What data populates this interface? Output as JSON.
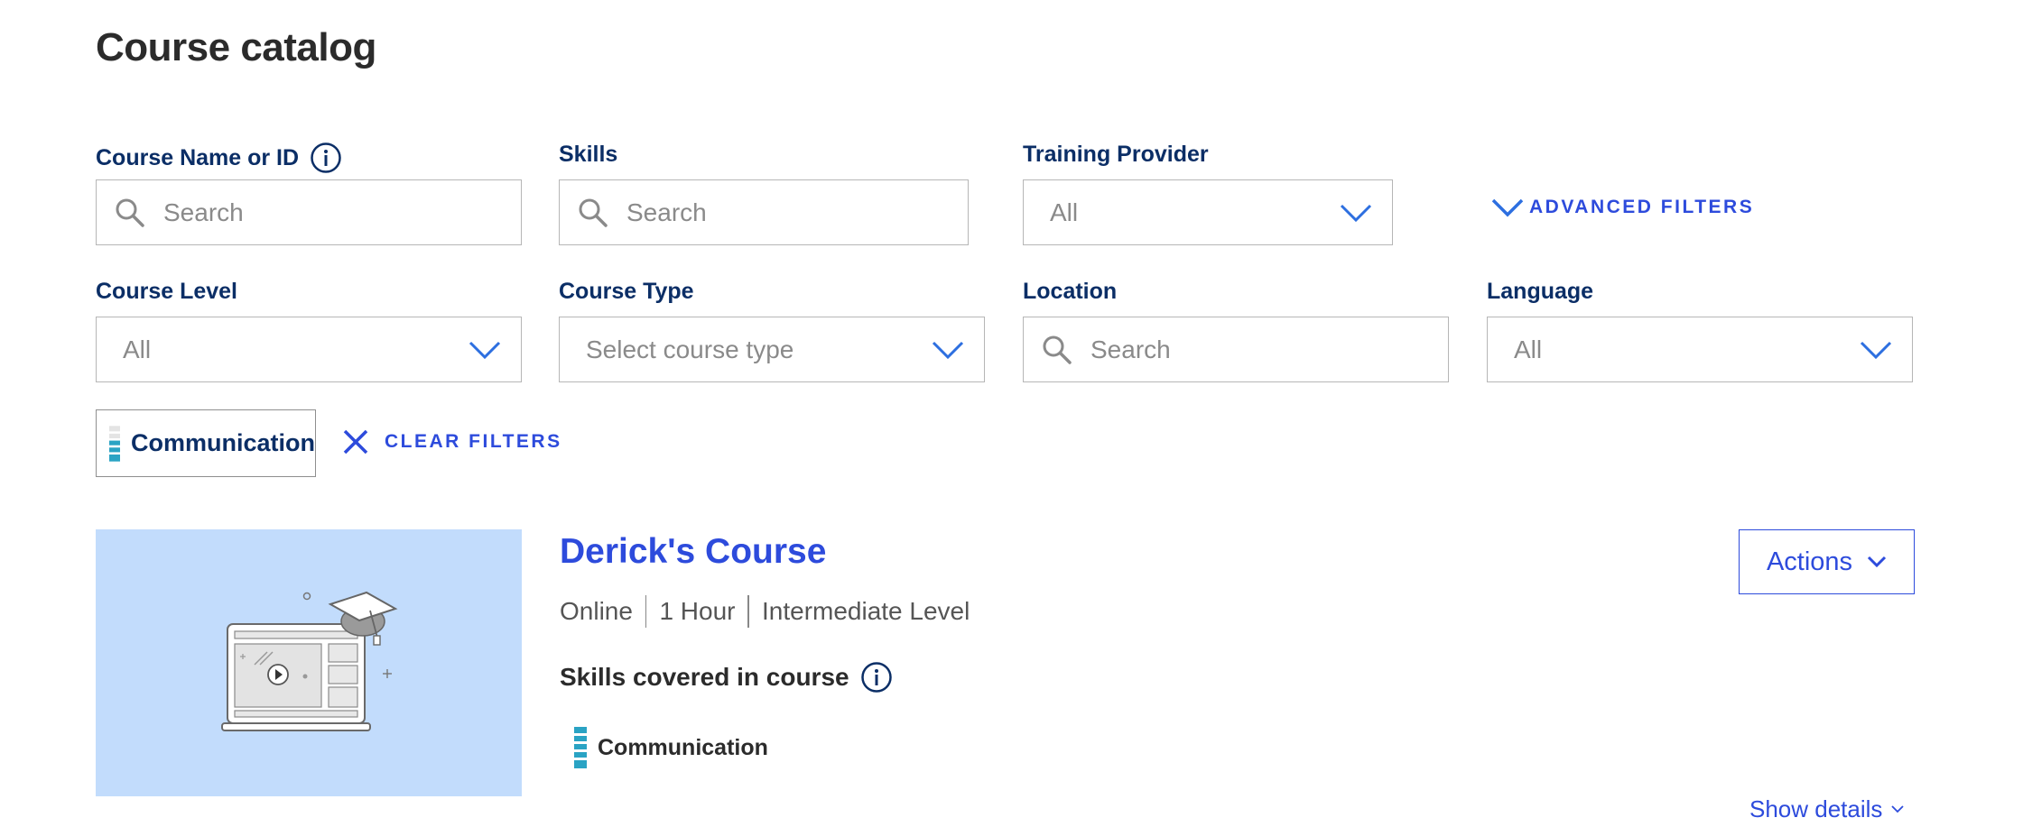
{
  "page": {
    "title": "Course catalog"
  },
  "filters": {
    "course_name": {
      "label": "Course Name or ID",
      "placeholder": "Search"
    },
    "skills": {
      "label": "Skills",
      "placeholder": "Search"
    },
    "training_provider": {
      "label": "Training Provider",
      "value": "All"
    },
    "advanced_filters_label": "ADVANCED FILTERS",
    "course_level": {
      "label": "Course Level",
      "value": "All"
    },
    "course_type": {
      "label": "Course Type",
      "value": "Select course type"
    },
    "location": {
      "label": "Location",
      "placeholder": "Search"
    },
    "language": {
      "label": "Language",
      "value": "All"
    }
  },
  "active_filters": {
    "chips": [
      {
        "label": "Communication",
        "level_icon": "skill-level-icon"
      }
    ],
    "clear_label": "CLEAR FILTERS"
  },
  "course": {
    "title": "Derick's Course",
    "meta": [
      "Online",
      "1 Hour",
      "Intermediate Level"
    ],
    "skills_heading": "Skills covered in course",
    "skills": [
      {
        "name": "Communication",
        "level_icon": "skill-level-icon"
      }
    ],
    "actions_label": "Actions",
    "show_details_label": "Show details"
  },
  "colors": {
    "accent": "#2d4bdc",
    "label": "#0b2e66",
    "thumbnail_bg": "#c2dcfc",
    "skill_level": "#2aa3c4"
  }
}
